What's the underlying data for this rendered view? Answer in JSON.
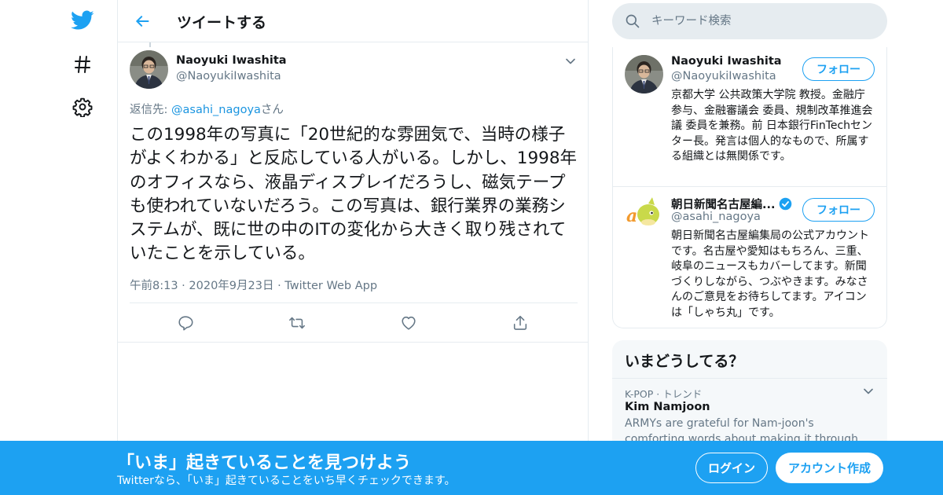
{
  "nav": {
    "items": [
      {
        "icon": "twitter-bird-icon"
      },
      {
        "icon": "hashtag-icon"
      },
      {
        "icon": "gear-icon"
      }
    ]
  },
  "header": {
    "title": "ツイートする"
  },
  "tweet": {
    "author_name": "Naoyuki Iwashita",
    "author_handle": "@NaoyukiIwashita",
    "reply_prefix": "返信先: ",
    "reply_handle": "@asahi_nagoya",
    "reply_suffix": "さん",
    "text": "この1998年の写真に「20世紀的な雰囲気で、当時の様子がよくわかる」と反応している人がいる。しかし、1998年のオフィスなら、液晶ディスプレイだろうし、磁気テープも使われていないだろう。この写真は、銀行業界の業務システムが、既に世の中のITの変化から大きく取り残されていたことを示している。",
    "time": "午前8:13",
    "date": "2020年9月23日",
    "source": "Twitter Web App",
    "separator": "·"
  },
  "search": {
    "placeholder": "キーワード検索"
  },
  "users": [
    {
      "name": "Naoyuki Iwashita",
      "handle": "@NaoyukiIwashita",
      "follow_label": "フォロー",
      "bio": "京都大学 公共政策大学院 教授。金融庁 参与、金融審議会 委員、規制改革推進会議 委員を兼務。前 日本銀行FinTechセンター長。発言は個人的なもので、所属する組織とは無関係です。",
      "verified": false
    },
    {
      "name": "朝日新聞名古屋編...",
      "handle": "@asahi_nagoya",
      "follow_label": "フォロー",
      "bio": "朝日新聞名古屋編集局の公式アカウントです。名古屋や愛知はもちろん、三重、岐阜のニュースもカバーしてます。新聞づくりしながら、つぶやきます。みなさんのご意見をお待ちしてます。アイコンは「しゃち丸」です。",
      "verified": true
    }
  ],
  "trends": {
    "title": "いまどうしてる？",
    "items": [
      {
        "meta": "K-POP · トレンド",
        "name": "Kim Namjoon",
        "description": "ARMYs are grateful for Nam-joon's comforting words about making it through tough times"
      }
    ]
  },
  "bottom_bar": {
    "title": "「いま」起きていることを見つけよう",
    "subtitle": "Twitterなら、「いま」起きていることをいち早くチェックできます。",
    "login_label": "ログイン",
    "signup_label": "アカウント作成"
  },
  "colors": {
    "brand": "#1da1f2",
    "link": "#1b95e0",
    "secondary_text": "#657786",
    "border": "#e6ecf0"
  }
}
